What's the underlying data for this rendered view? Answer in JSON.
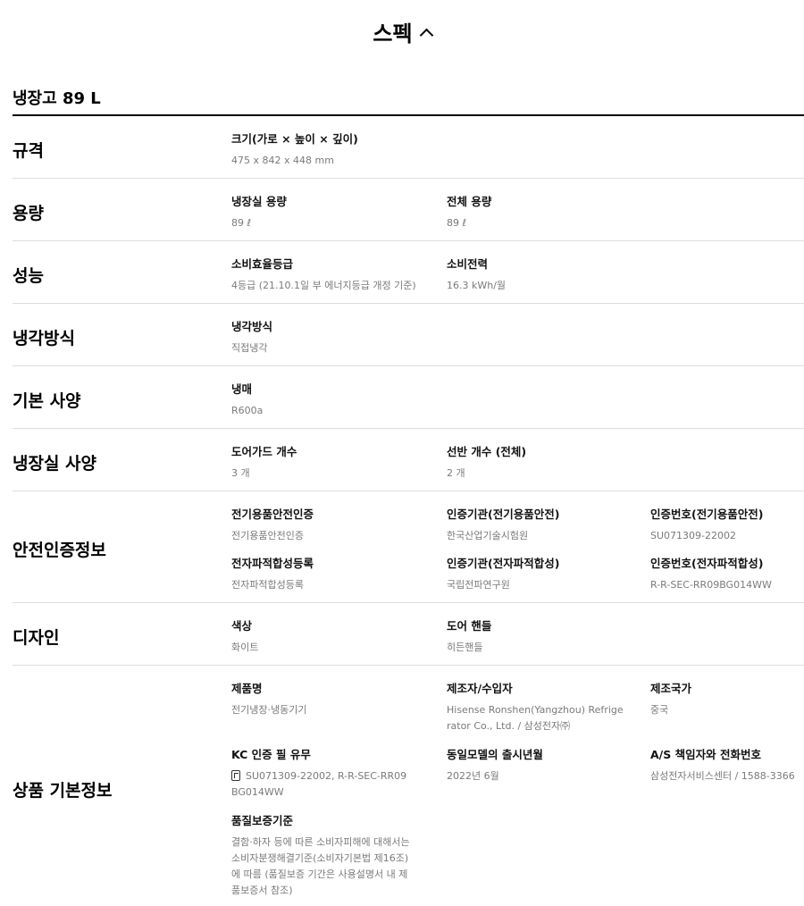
{
  "header": {
    "title": "스펙"
  },
  "product": {
    "name": "냉장고 89 L"
  },
  "rows": {
    "size": {
      "title": "규격",
      "items": [
        {
          "label": "크기(가로 × 높이 × 깊이)",
          "value": "475 x 842 x 448 mm"
        }
      ]
    },
    "capacity": {
      "title": "용량",
      "items": [
        {
          "label": "냉장실 용량",
          "value": "89 ℓ"
        },
        {
          "label": "전체 용량",
          "value": "89 ℓ"
        }
      ]
    },
    "performance": {
      "title": "성능",
      "items": [
        {
          "label": "소비효율등급",
          "value": "4등급 (21.10.1일 부 에너지등급 개정 기준)"
        },
        {
          "label": "소비전력",
          "value": "16.3 kWh/월"
        }
      ]
    },
    "cooling": {
      "title": "냉각방식",
      "items": [
        {
          "label": "냉각방식",
          "value": "직접냉각"
        }
      ]
    },
    "basic": {
      "title": "기본 사양",
      "items": [
        {
          "label": "냉매",
          "value": "R600a"
        }
      ]
    },
    "fridge": {
      "title": "냉장실 사양",
      "items": [
        {
          "label": "도어가드 개수",
          "value": "3 개"
        },
        {
          "label": "선반 개수 (전체)",
          "value": "2 개"
        }
      ]
    },
    "safety": {
      "title": "안전인증정보",
      "items": [
        {
          "label": "전기용품안전인증",
          "value": "전기용품안전인증"
        },
        {
          "label": "인증기관(전기용품안전)",
          "value": "한국산업기술시험원"
        },
        {
          "label": "인증번호(전기용품안전)",
          "value": "SU071309-22002"
        },
        {
          "label": "전자파적합성등록",
          "value": "전자파적합성등록"
        },
        {
          "label": "인증기관(전자파적합성)",
          "value": "국립전파연구원"
        },
        {
          "label": "인증번호(전자파적합성)",
          "value": "R-R-SEC-RR09BG014WW"
        }
      ]
    },
    "design": {
      "title": "디자인",
      "items": [
        {
          "label": "색상",
          "value": "화이트"
        },
        {
          "label": "도어 핸들",
          "value": "히든핸들"
        }
      ]
    },
    "info": {
      "title": "상품 기본정보",
      "items": [
        {
          "label": "제품명",
          "value": "전기냉장·냉동기기"
        },
        {
          "label": "제조자/수입자",
          "value": "Hisense Ronshen(Yangzhou) Refrigerator Co., Ltd. / 삼성전자㈜"
        },
        {
          "label": "제조국가",
          "value": "중국"
        },
        {
          "label": "KC 인증 필 유무",
          "value": "SU071309-22002, R-R-SEC-RR09BG014WW"
        },
        {
          "label": "동일모델의 출시년월",
          "value": "2022년 6월"
        },
        {
          "label": "A/S 책임자와 전화번호",
          "value": "삼성전자서비스센터 / 1588-3366"
        },
        {
          "label": "품질보증기준",
          "value": "결함·하자 등에 따른 소비자피해에 대해서는 소비자분쟁해결기준(소비자기본법 제16조)에 따름 (품질보증 기간은 사용설명서 내 제품보증서 참조)"
        }
      ]
    }
  }
}
